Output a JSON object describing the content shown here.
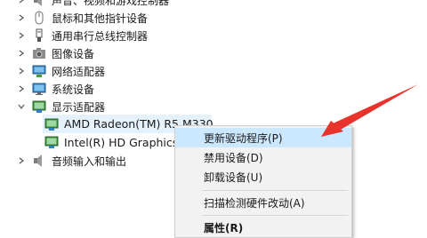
{
  "tree": {
    "items": [
      {
        "label": "声音、视频和游戏控制器",
        "icon": "speaker-icon",
        "expanded": false
      },
      {
        "label": "鼠标和其他指针设备",
        "icon": "mouse-icon",
        "expanded": false
      },
      {
        "label": "通用串行总线控制器",
        "icon": "usb-icon",
        "expanded": false
      },
      {
        "label": "图像设备",
        "icon": "camera-icon",
        "expanded": false
      },
      {
        "label": "网络适配器",
        "icon": "network-adapter-icon",
        "expanded": false
      },
      {
        "label": "系统设备",
        "icon": "system-device-icon",
        "expanded": false
      },
      {
        "label": "显示适配器",
        "icon": "display-adapter-icon",
        "expanded": true
      },
      {
        "label": "AMD Radeon(TM) R5 M330",
        "icon": "display-adapter-icon",
        "child": true,
        "selected": true
      },
      {
        "label": "Intel(R) HD Graphics",
        "icon": "display-adapter-icon",
        "child": true
      },
      {
        "label": "音频输入和输出",
        "icon": "speaker-icon",
        "expanded": false
      }
    ]
  },
  "context_menu": {
    "items": [
      {
        "label": "更新驱动程序(P)",
        "highlighted": true
      },
      {
        "label": "禁用设备(D)"
      },
      {
        "label": "卸载设备(U)"
      },
      {
        "label": "扫描检测硬件改动(A)"
      },
      {
        "label": "属性(R)"
      }
    ]
  },
  "colors": {
    "selection": "#e5f1fb",
    "menu_highlight": "#cce8ff",
    "arrow": "#e8322b"
  }
}
